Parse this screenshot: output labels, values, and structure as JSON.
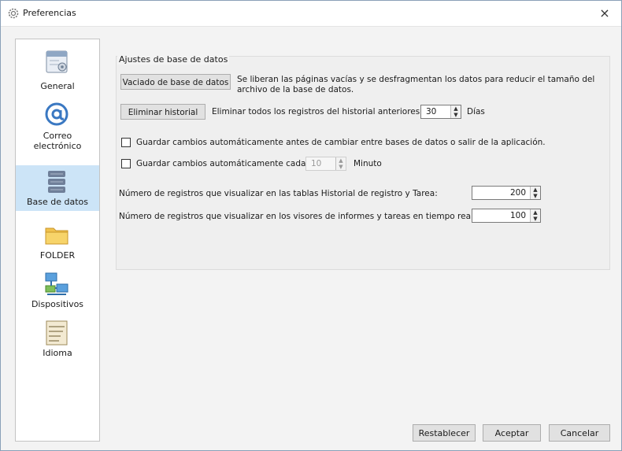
{
  "window": {
    "title": "Preferencias",
    "close_glyph": "×"
  },
  "sidebar": {
    "items": [
      {
        "label": "General",
        "icon": "calendar-settings-icon",
        "active": false
      },
      {
        "label": "Correo\nelectrónico",
        "icon": "at-sign-icon",
        "active": false
      },
      {
        "label": "Base de datos",
        "icon": "database-icon",
        "active": true
      },
      {
        "label": "FOLDER",
        "icon": "folder-icon",
        "active": false
      },
      {
        "label": "Dispositivos",
        "icon": "network-devices-icon",
        "active": false
      },
      {
        "label": "Idioma",
        "icon": "language-icon",
        "active": false
      }
    ]
  },
  "database": {
    "group_title": "Ajustes de base de datos",
    "vacuum_button": "Vaciado de base de datos",
    "vacuum_desc_line1": "Se liberan las páginas vacías y se desfragmentan los datos para reducir el tamaño del",
    "vacuum_desc_line2": "archivo de la base de datos.",
    "delete_history_button": "Eliminar historial",
    "delete_history_desc": "Eliminar todos los registros del historial anteriores a",
    "delete_history_days": "30",
    "days_label": "Días",
    "autosave_switch_label": "Guardar cambios automáticamente antes de cambiar entre bases de datos o salir de la aplicación.",
    "autosave_switch_checked": false,
    "autosave_interval_label": "Guardar cambios automáticamente cada",
    "autosave_interval_checked": false,
    "autosave_interval_value": "10",
    "minutes_label": "Minuto",
    "history_rows_label": "Número de registros que visualizar en las tablas Historial de registro y Tarea:",
    "history_rows_value": "200",
    "viewer_rows_label": "Número de registros que visualizar en los visores de informes y tareas en tiempo real:",
    "viewer_rows_value": "100"
  },
  "footer": {
    "reset_button": "Restablecer",
    "accept_button": "Aceptar",
    "cancel_button": "Cancelar"
  },
  "colors": {
    "active_item_bg": "#cce4f7",
    "button_bg": "#e1e1e1",
    "window_bg": "#f3f3f3"
  }
}
